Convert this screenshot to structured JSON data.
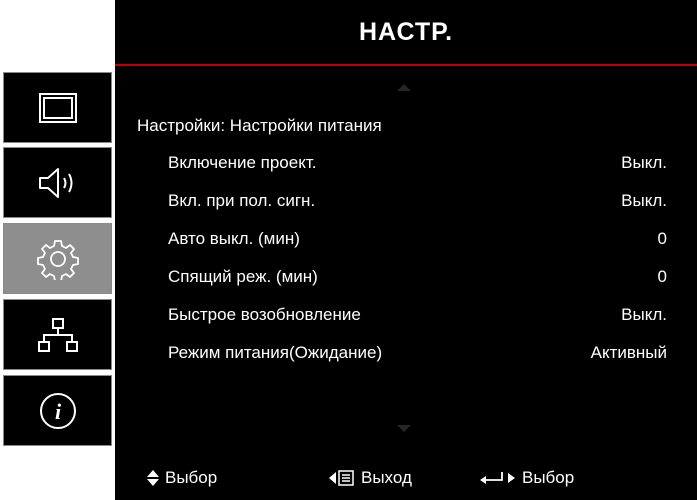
{
  "menu": {
    "title": "НАСТР.",
    "breadcrumb": "Настройки: Настройки питания"
  },
  "sidebar": {
    "items": [
      {
        "icon": "display-icon",
        "active": false
      },
      {
        "icon": "speaker-icon",
        "active": false
      },
      {
        "icon": "gear-icon",
        "active": true
      },
      {
        "icon": "network-icon",
        "active": false
      },
      {
        "icon": "info-icon",
        "active": false
      }
    ]
  },
  "settings": [
    {
      "label": "Включение проект.",
      "value": "Выкл."
    },
    {
      "label": "Вкл. при пол. сигн.",
      "value": "Выкл."
    },
    {
      "label": "Авто выкл. (мин)",
      "value": "0"
    },
    {
      "label": "Спящий реж. (мин)",
      "value": "0"
    },
    {
      "label": "Быстрое возобновление",
      "value": "Выкл."
    },
    {
      "label": "Режим питания(Ожидание)",
      "value": "Активный"
    }
  ],
  "footer": {
    "select_label": "Выбор",
    "exit_label": "Выход",
    "enter_label": "Выбор"
  },
  "colors": {
    "accent_line": "#c00000",
    "active_tab": "#8e8e8e",
    "background": "#000000"
  }
}
